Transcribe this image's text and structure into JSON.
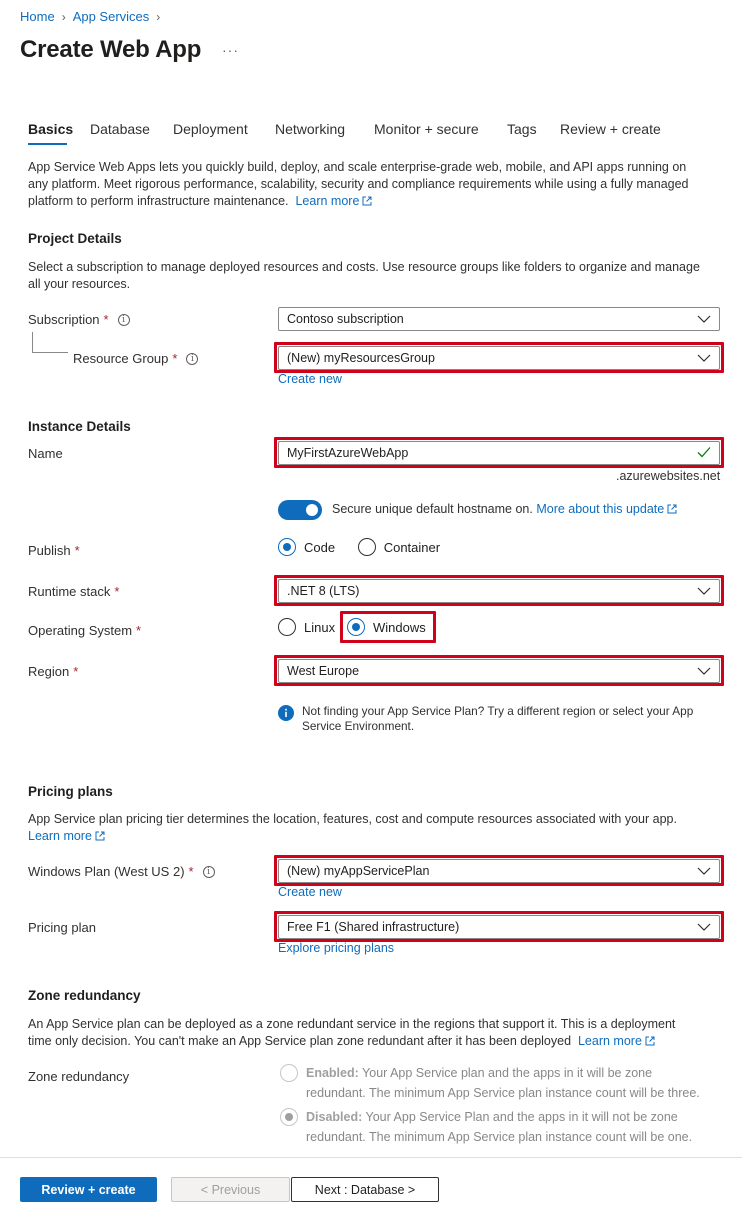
{
  "breadcrumb": {
    "home": "Home",
    "app_services": "App Services"
  },
  "page": {
    "title": "Create Web App",
    "more": "···"
  },
  "tabs": [
    {
      "label": "Basics"
    },
    {
      "label": "Database"
    },
    {
      "label": "Deployment"
    },
    {
      "label": "Networking"
    },
    {
      "label": "Monitor + secure"
    },
    {
      "label": "Tags"
    },
    {
      "label": "Review + create"
    }
  ],
  "intro": {
    "line1": "App Service Web Apps lets you quickly build, deploy, and scale enterprise-grade web, mobile, and API apps running on",
    "line2": "any platform. Meet rigorous performance, scalability, security and compliance requirements while using a fully managed",
    "line3": "platform to perform infrastructure maintenance.",
    "learn_more": "Learn more"
  },
  "project": {
    "heading": "Project Details",
    "desc1": "Select a subscription to manage deployed resources and costs. Use resource groups like folders to organize and manage",
    "desc2": "all your resources.",
    "subscription_label": "Subscription",
    "subscription_value": "Contoso subscription",
    "rg_label": "Resource Group",
    "rg_value": "(New) myResourcesGroup",
    "create_new": "Create new"
  },
  "instance": {
    "heading": "Instance Details",
    "name_label": "Name",
    "name_value": "MyFirstAzureWebApp",
    "name_suffix": ".azurewebsites.net",
    "secure_text": "Secure unique default hostname on.",
    "secure_link": "More about this update",
    "publish_label": "Publish",
    "publish_code": "Code",
    "publish_container": "Container",
    "runtime_label": "Runtime stack",
    "runtime_value": ".NET 8 (LTS)",
    "os_label": "Operating System",
    "os_linux": "Linux",
    "os_windows": "Windows",
    "region_label": "Region",
    "region_value": "West Europe",
    "region_info1": "Not finding your App Service Plan? Try a different region or select your App",
    "region_info2": "Service Environment."
  },
  "pricing": {
    "heading": "Pricing plans",
    "desc": "App Service plan pricing tier determines the location, features, cost and compute resources associated with your app.",
    "learn_more": "Learn more",
    "plan_label": "Windows Plan (West US 2)",
    "plan_value": "(New) myAppServicePlan",
    "create_new": "Create new",
    "pricing_label": "Pricing plan",
    "pricing_value": "Free F1 (Shared infrastructure)",
    "explore": "Explore pricing plans"
  },
  "zone": {
    "heading": "Zone redundancy",
    "desc1": "An App Service plan can be deployed as a zone redundant service in the regions that support it. This is a deployment",
    "desc2": "time only decision. You can't make an App Service plan zone redundant after it has been deployed",
    "learn_more": "Learn more",
    "label": "Zone redundancy",
    "enabled_title": "Enabled:",
    "enabled_text1": "Your App Service plan and the apps in it will be zone",
    "enabled_text2": "redundant. The minimum App Service plan instance count will be three.",
    "disabled_title": "Disabled:",
    "disabled_text1": "Your App Service Plan and the apps in it will not be zone",
    "disabled_text2": "redundant. The minimum App Service plan instance count will be one."
  },
  "footer": {
    "review": "Review + create",
    "previous": "< Previous",
    "next": "Next : Database >"
  },
  "colors": {
    "accent": "#0f6cbd",
    "highlight": "#d0021b",
    "required": "#a4262c",
    "valid": "#107c10"
  },
  "required_mark": "*",
  "info_mark": "i"
}
